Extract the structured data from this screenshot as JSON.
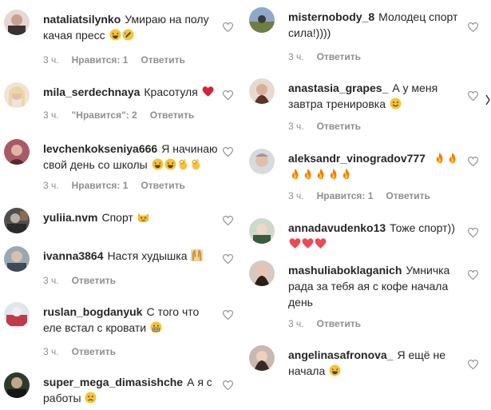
{
  "colors": {
    "text": "#262626",
    "meta": "#8e8e8e",
    "emoji_yellow": "#f5c33b",
    "heart_red": "#ed4956",
    "fire": "#f57c00"
  },
  "left_comments": [
    {
      "user": "nataliatsilynko",
      "text": "Умираю на полу качая пресс",
      "emojis": [
        "laughing",
        "rolling"
      ],
      "time": "3 ч.",
      "likes": "Нравится: 1",
      "reply": "Ответить"
    },
    {
      "user": "mila_serdechnaya",
      "text": "Красотуля",
      "emojis": [
        "heart"
      ],
      "time": "3 ч.",
      "likes": "\"Нравится\": 2",
      "reply": "Ответить"
    },
    {
      "user": "levchenkokseniya666",
      "text": "Я начинаю свой день со школы",
      "emojis": [
        "laughing",
        "laughing",
        "ok-hand",
        "ok-hand"
      ],
      "time": "3 ч.",
      "likes": "Нравится: 1",
      "reply": "Ответить"
    },
    {
      "user": "yuliia.nvm",
      "text": "Спорт",
      "emojis": [
        "cat"
      ],
      "time": "",
      "likes": "",
      "reply": ""
    },
    {
      "user": "ivanna3864",
      "text": "Настя худышка",
      "emojis": [
        "hands"
      ],
      "time": "3 ч.",
      "likes": "",
      "reply": "Ответить"
    },
    {
      "user": "ruslan_bogdanyuk",
      "text": "С того что еле встал с кровати",
      "emojis": [
        "grimace"
      ],
      "time": "3 ч.",
      "likes": "",
      "reply": "Ответить"
    },
    {
      "user": "super_mega_dimasishche",
      "text": "А я с работы",
      "emojis": [
        "sad"
      ],
      "time": "",
      "likes": "",
      "reply": ""
    }
  ],
  "right_comments": [
    {
      "user": "misternobody_8",
      "text": "Молодец спорт сила!))))",
      "emojis": [],
      "time": "3 ч.",
      "likes": "",
      "reply": "Ответить"
    },
    {
      "user": "anastasia_grapes_",
      "text": "А у меня завтра тренировка",
      "emojis": [
        "smile"
      ],
      "time": "3 ч.",
      "likes": "",
      "reply": "Ответить"
    },
    {
      "user": "aleksandr_vinogradov777",
      "text": "",
      "emojis": [
        "fire",
        "fire",
        "fire",
        "fire",
        "fire",
        "fire",
        "fire"
      ],
      "time": "3 ч.",
      "likes": "Нравится: 1",
      "reply": "Ответить"
    },
    {
      "user": "annadavudenko13",
      "text": "Тоже спорт))",
      "emojis": [
        "heart",
        "heart",
        "heart"
      ],
      "time": "",
      "likes": "",
      "reply": ""
    },
    {
      "user": "mashuliaboklaganich",
      "text": "Умничка рада за тебя ая с кофе начала день",
      "emojis": [],
      "time": "3 ч.",
      "likes": "",
      "reply": "Ответить"
    },
    {
      "user": "angelinasafronova_",
      "text": "Я ещё не начала",
      "emojis": [
        "laughing"
      ],
      "time": "",
      "likes": "",
      "reply": ""
    }
  ]
}
